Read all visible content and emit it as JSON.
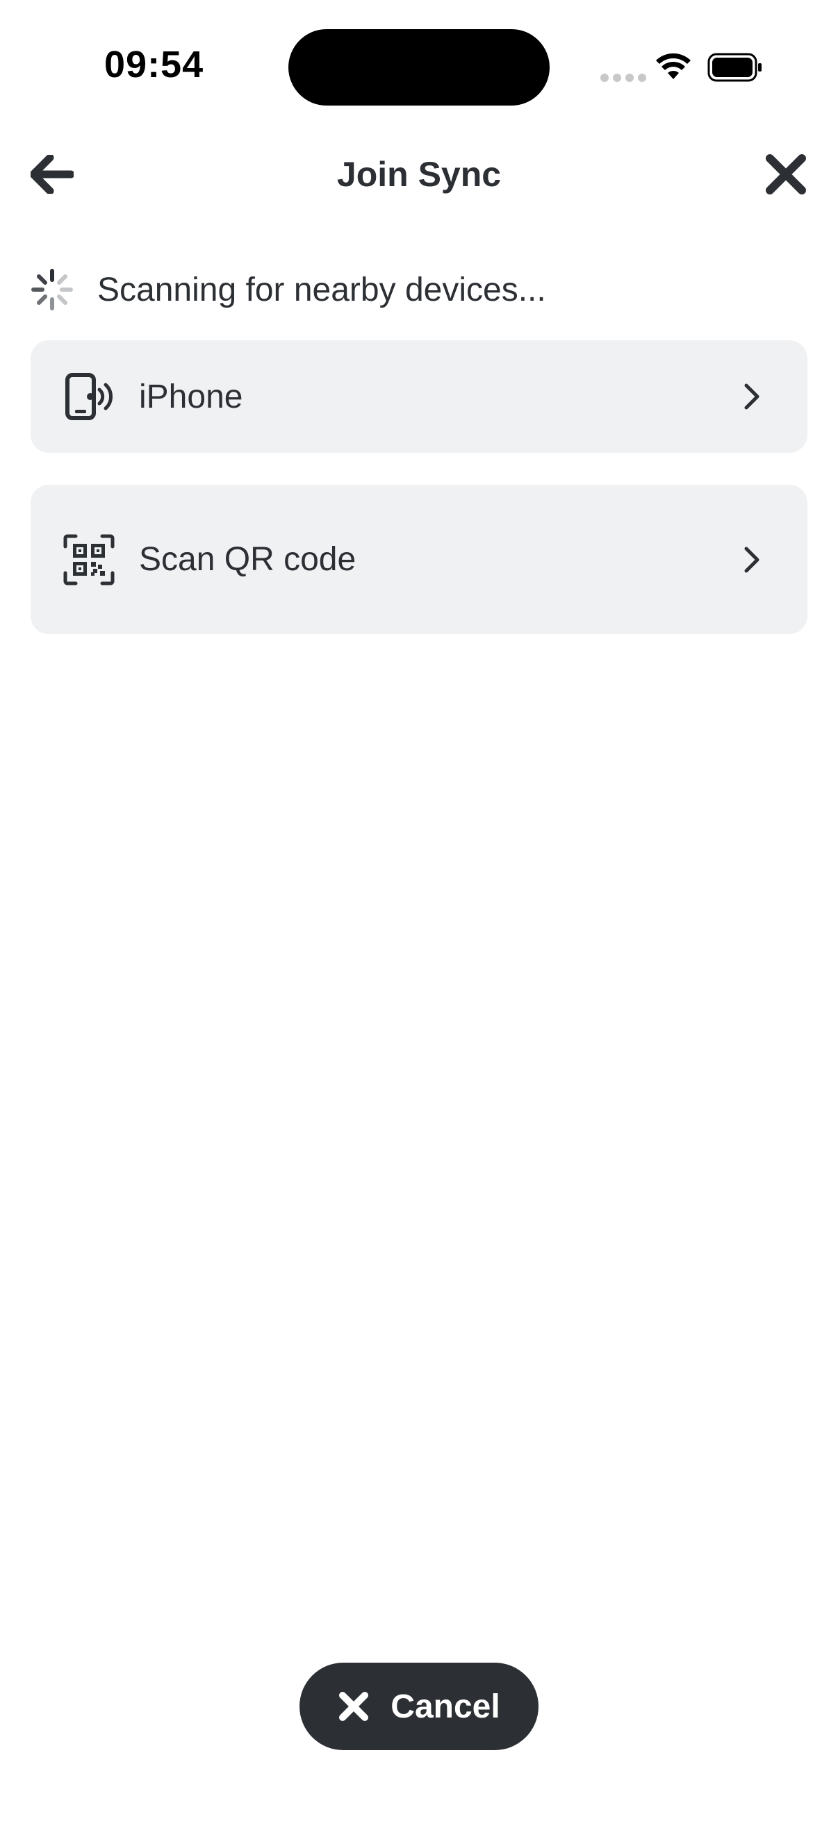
{
  "status_bar": {
    "time": "09:54"
  },
  "header": {
    "title": "Join Sync",
    "back_icon": "arrow-left-icon",
    "close_icon": "close-icon"
  },
  "scanning": {
    "text": "Scanning for nearby devices...",
    "icon": "loading-spinner-icon"
  },
  "options": [
    {
      "label": "iPhone",
      "icon": "phone-wireless-icon"
    },
    {
      "label": "Scan QR code",
      "icon": "qr-code-icon"
    }
  ],
  "footer": {
    "cancel_label": "Cancel",
    "cancel_icon": "close-icon"
  },
  "colors": {
    "text": "#2c2f33",
    "card_background": "#f0f1f3",
    "button_background": "#2c2f33",
    "button_text": "#ffffff"
  }
}
